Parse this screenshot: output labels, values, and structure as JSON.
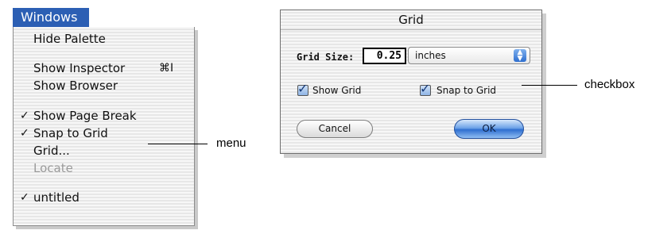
{
  "menu": {
    "title": "Windows",
    "items": [
      {
        "label": "Hide Palette",
        "checked": false,
        "shortcut": "",
        "enabled": true
      },
      {
        "label": "Show Inspector",
        "checked": false,
        "shortcut": "⌘I",
        "enabled": true
      },
      {
        "label": "Show Browser",
        "checked": false,
        "shortcut": "",
        "enabled": true
      },
      {
        "label": "Show Page Break",
        "checked": true,
        "shortcut": "",
        "enabled": true
      },
      {
        "label": "Snap to Grid",
        "checked": true,
        "shortcut": "",
        "enabled": true
      },
      {
        "label": "Grid...",
        "checked": false,
        "shortcut": "",
        "enabled": true
      },
      {
        "label": "Locate",
        "checked": false,
        "shortcut": "",
        "enabled": false
      },
      {
        "label": "untitled",
        "checked": true,
        "shortcut": "",
        "enabled": true
      }
    ],
    "check_glyph": "✓"
  },
  "callouts": {
    "menu": "menu",
    "checkbox": "checkbox"
  },
  "dialog": {
    "title": "Grid",
    "grid_size_label": "Grid Size:",
    "grid_size_value": "0.25",
    "units": "inches",
    "show_grid_label": "Show Grid",
    "show_grid_checked": true,
    "snap_to_grid_label": "Snap to Grid",
    "snap_to_grid_checked": true,
    "cancel_label": "Cancel",
    "ok_label": "OK"
  },
  "colors": {
    "menu_highlight": "#2c5fb4",
    "default_button": "#2f6fd0"
  },
  "icons": {
    "checkmark": "checkmark-icon",
    "popup_arrows": "popup-arrows-icon",
    "checkbox_check": "checkbox-check-icon"
  }
}
